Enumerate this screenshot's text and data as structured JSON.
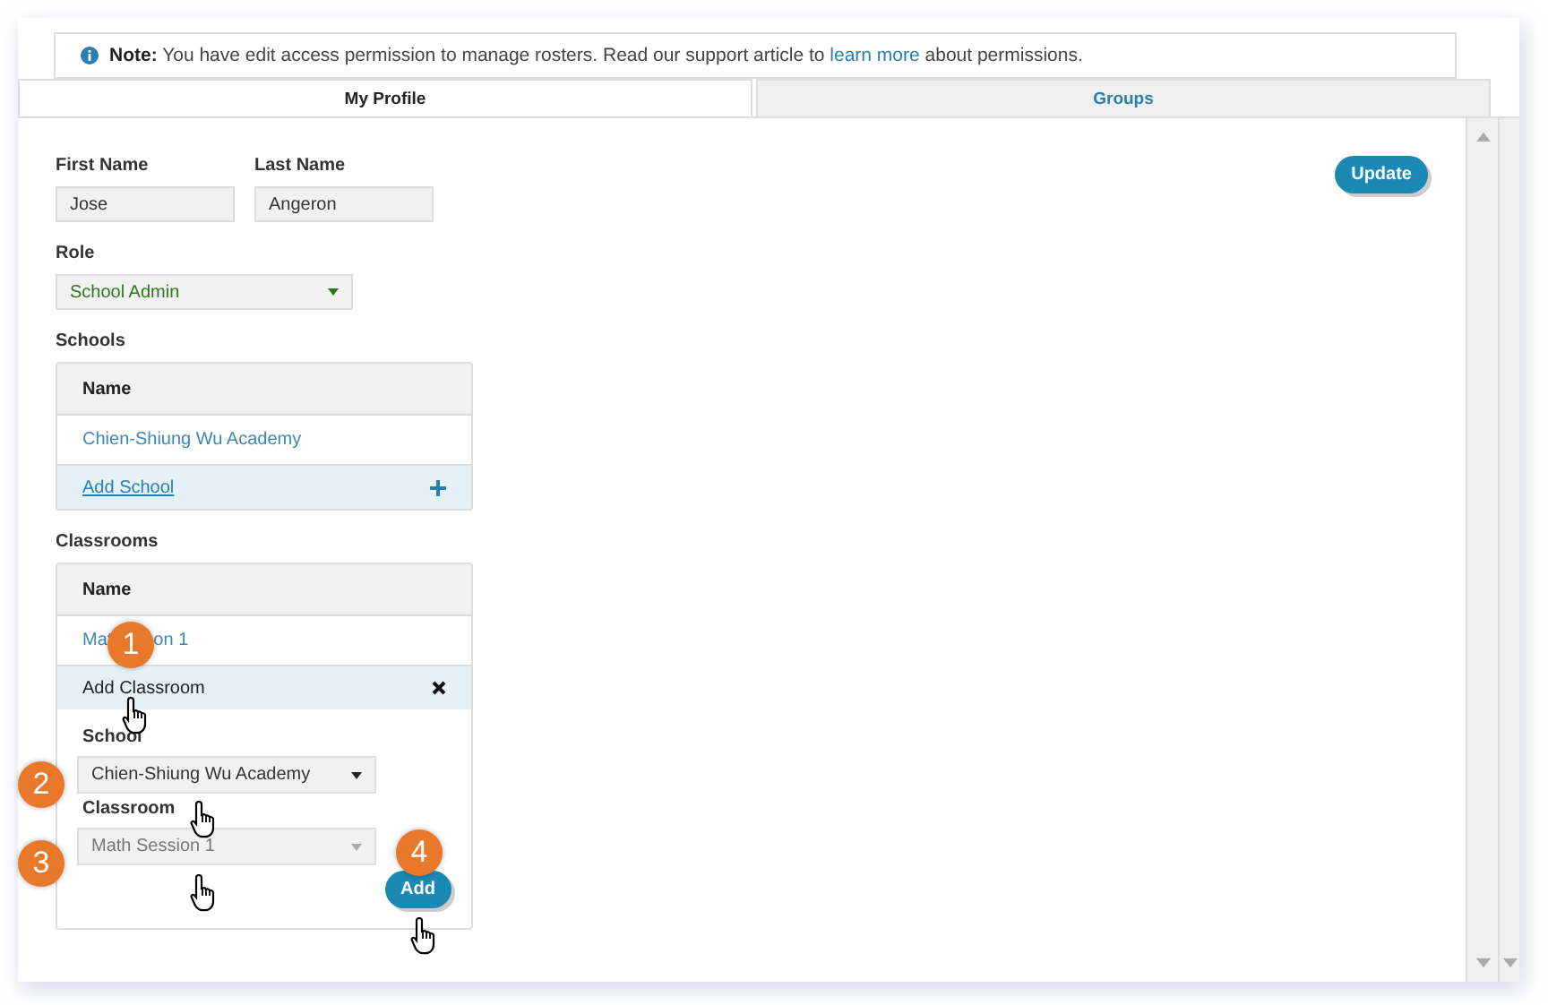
{
  "note": {
    "text": "**Note:** You have edit access permission to manage rosters. Read our support article to",
    "link": "learn more",
    "text_after": "about permissions."
  },
  "tabs": [
    {
      "label": "My Profile",
      "selected": true
    },
    {
      "label": "Groups",
      "selected": false
    }
  ],
  "first_name": {
    "label": "First Name",
    "value": "Jose"
  },
  "last_name": {
    "label": "Last Name",
    "value": "Angeron"
  },
  "role": {
    "label": "Role",
    "value": "School Admin"
  },
  "update_button": "Update",
  "schools": {
    "label": "Schools",
    "column": "Name",
    "rows": [
      "Chien-Shiung Wu Academy"
    ],
    "add_link": "Add School"
  },
  "classrooms": {
    "label": "Classrooms",
    "column": "Name",
    "rows": [
      [
        "Mat",
        "on 1"
      ]
    ],
    "add_row": {
      "label": "Add Classroom",
      "expanded": true
    },
    "school_field": {
      "label": "School",
      "value": "Chien-Shiung Wu Academy",
      "disabled": false
    },
    "classroom_field": {
      "label": "Classroom",
      "value": "Math Session 1",
      "disabled": true
    },
    "add_button": "Add"
  },
  "callouts": [
    "1",
    "2",
    "3",
    "4"
  ]
}
